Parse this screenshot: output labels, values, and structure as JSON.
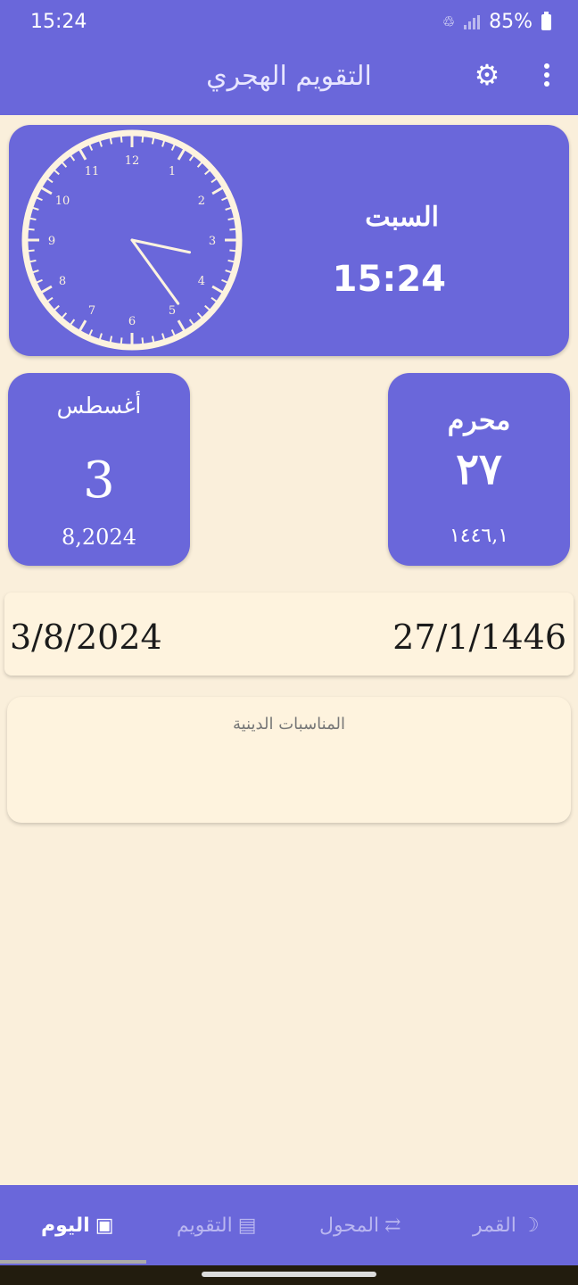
{
  "status_bar": {
    "time": "15:24",
    "battery": "85%"
  },
  "app_bar": {
    "title": "التقويم الهجري",
    "settings_icon": "gear-icon",
    "menu_icon": "more-vert-icon"
  },
  "clock_card": {
    "day_name": "السبت",
    "time": "15:24",
    "clock_numbers": [
      "12",
      "1",
      "2",
      "3",
      "4",
      "5",
      "6",
      "7",
      "8",
      "9",
      "10",
      "11"
    ],
    "hour": 15,
    "minute": 24
  },
  "gregorian_card": {
    "month": "أغسطس",
    "day": "3",
    "sub": "8,2024"
  },
  "hijri_card": {
    "month": "محرم",
    "day": "٢٧",
    "sub": "١٤٤٦,١"
  },
  "date_bar": {
    "gregorian": "3/8/2024",
    "hijri": "27/1/1446"
  },
  "events_card": {
    "title": "المناسبات الدينية"
  },
  "bottom_nav": [
    {
      "label": "اليوم",
      "icon": "calendar-today-icon",
      "active": true
    },
    {
      "label": "التقويم",
      "icon": "calendar-icon",
      "active": false
    },
    {
      "label": "المحول",
      "icon": "convert-arrows-icon",
      "active": false
    },
    {
      "label": "القمر",
      "icon": "moon-icon",
      "active": false
    }
  ],
  "colors": {
    "primary": "#6A67DA",
    "background": "#FAEFDB",
    "card_light": "#FEF3DE"
  }
}
